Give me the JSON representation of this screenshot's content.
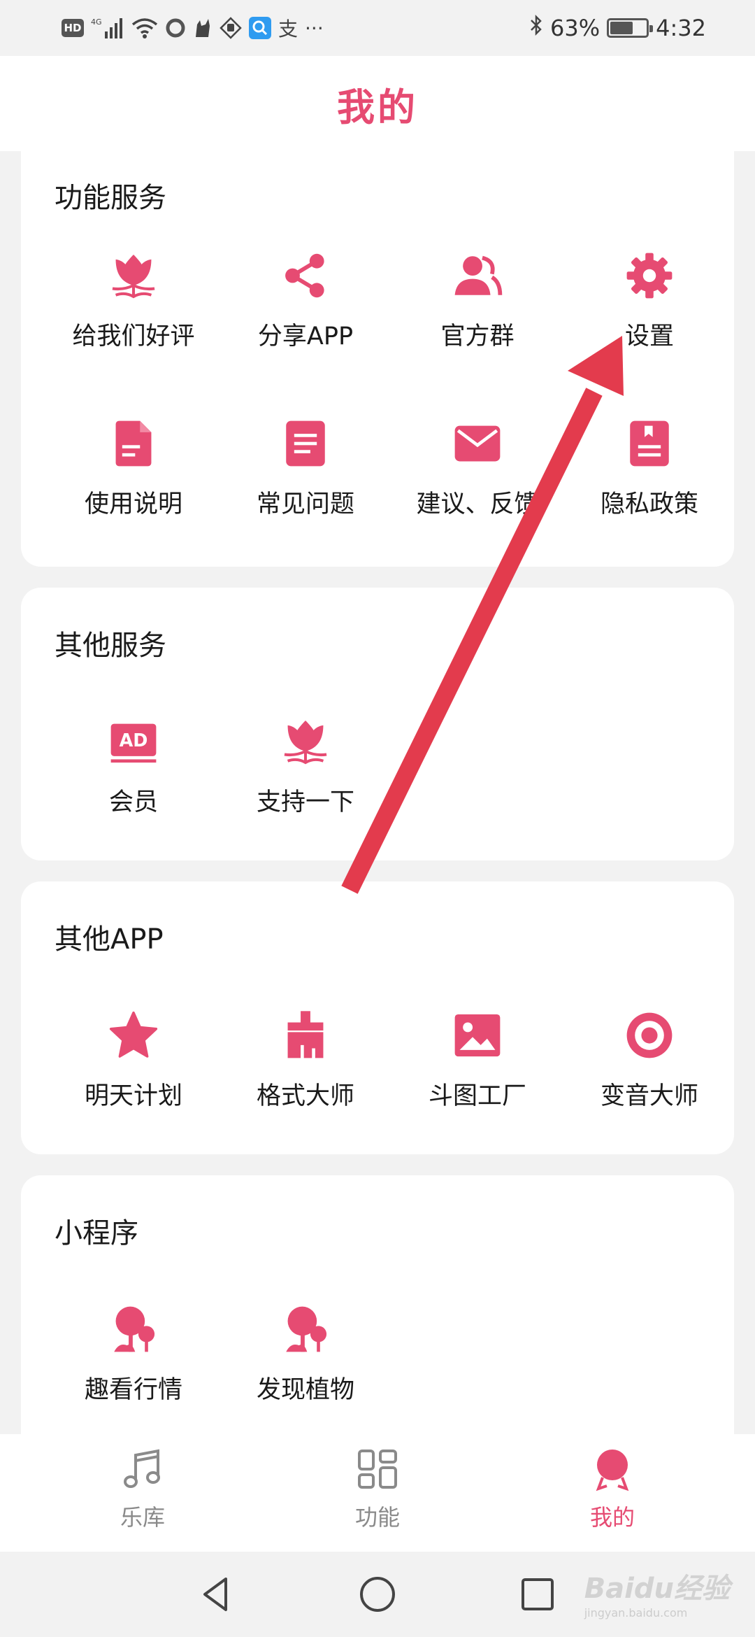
{
  "status_bar": {
    "hd": "HD",
    "signal": "4G",
    "battery_percent": "63%",
    "battery_level": 0.63,
    "time": "4:32",
    "alipay_glyph": "支",
    "more": "···"
  },
  "header": {
    "title": "我的"
  },
  "sections": [
    {
      "title": "功能服务",
      "items": [
        {
          "label": "给我们好评",
          "icon": "tulip-icon"
        },
        {
          "label": "分享APP",
          "icon": "share-icon"
        },
        {
          "label": "官方群",
          "icon": "group-icon"
        },
        {
          "label": "设置",
          "icon": "gear-icon"
        },
        {
          "label": "使用说明",
          "icon": "document-icon"
        },
        {
          "label": "常见问题",
          "icon": "faq-icon"
        },
        {
          "label": "建议、反馈",
          "icon": "mail-icon"
        },
        {
          "label": "隐私政策",
          "icon": "privacy-book-icon"
        }
      ]
    },
    {
      "title": "其他服务",
      "items": [
        {
          "label": "会员",
          "icon": "ad-icon",
          "badge": "AD"
        },
        {
          "label": "支持一下",
          "icon": "tulip-icon"
        }
      ]
    },
    {
      "title": "其他APP",
      "items": [
        {
          "label": "明天计划",
          "icon": "star-icon"
        },
        {
          "label": "格式大师",
          "icon": "brush-icon"
        },
        {
          "label": "斗图工厂",
          "icon": "image-icon"
        },
        {
          "label": "变音大师",
          "icon": "target-icon"
        }
      ]
    },
    {
      "title": "小程序",
      "items": [
        {
          "label": "趣看行情",
          "icon": "tree-icon"
        },
        {
          "label": "发现植物",
          "icon": "tree-icon"
        }
      ]
    }
  ],
  "bottom_nav": [
    {
      "label": "乐库",
      "icon": "music-note-icon",
      "active": false
    },
    {
      "label": "功能",
      "icon": "grid-icon",
      "active": false
    },
    {
      "label": "我的",
      "icon": "profile-icon",
      "active": true
    }
  ],
  "watermark": {
    "brand": "Baidu经验",
    "url": "jingyan.baidu.com"
  },
  "colors": {
    "accent": "#e64b72",
    "annotation_arrow": "#e33b4d",
    "background": "#f2f2f2"
  }
}
